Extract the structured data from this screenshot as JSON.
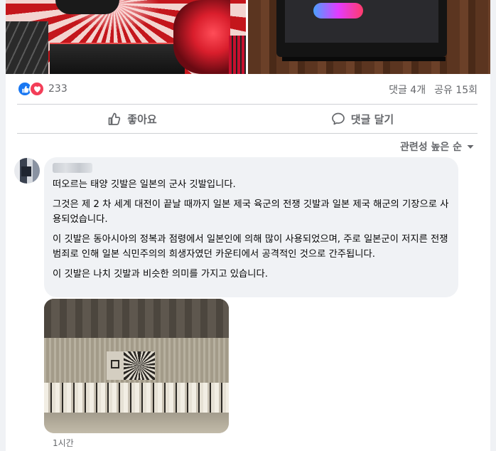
{
  "post": {
    "reaction_count": "233",
    "comments_count": "댓글 4개",
    "shares_count": "공유 15회",
    "reaction_icons": [
      "like-icon",
      "love-icon"
    ]
  },
  "actions": {
    "like_label": "좋아요",
    "comment_label": "댓글 달기"
  },
  "sort": {
    "label": "관련성 높은 순"
  },
  "comment": {
    "paragraphs": [
      "떠오르는 태양 깃발은 일본의 군사 깃발입니다.",
      "그것은 제 2 차 세계 대전이 끝날 때까지 일본 제국 육군의 전쟁 깃발과 일본 제국 해군의 기장으로 사용되었습니다.",
      "이 깃발은 동아시아의 정복과 점령에서 일본인에 의해 많이 사용되었으며, 주로 일본군이 저지른 전쟁 범죄로 인해 일본 식민주의의 희생자였던 카운티에서 공격적인 것으로 간주됩니다.",
      "이 깃발은 나치 깃발과 비슷한 의미를 가지고 있습니다."
    ],
    "timestamp": "1시간"
  },
  "colors": {
    "like_blue": "#1877f2",
    "love_red": "#f33e58",
    "secondary_text": "#65676b",
    "bubble_bg": "#f0f2f5"
  }
}
